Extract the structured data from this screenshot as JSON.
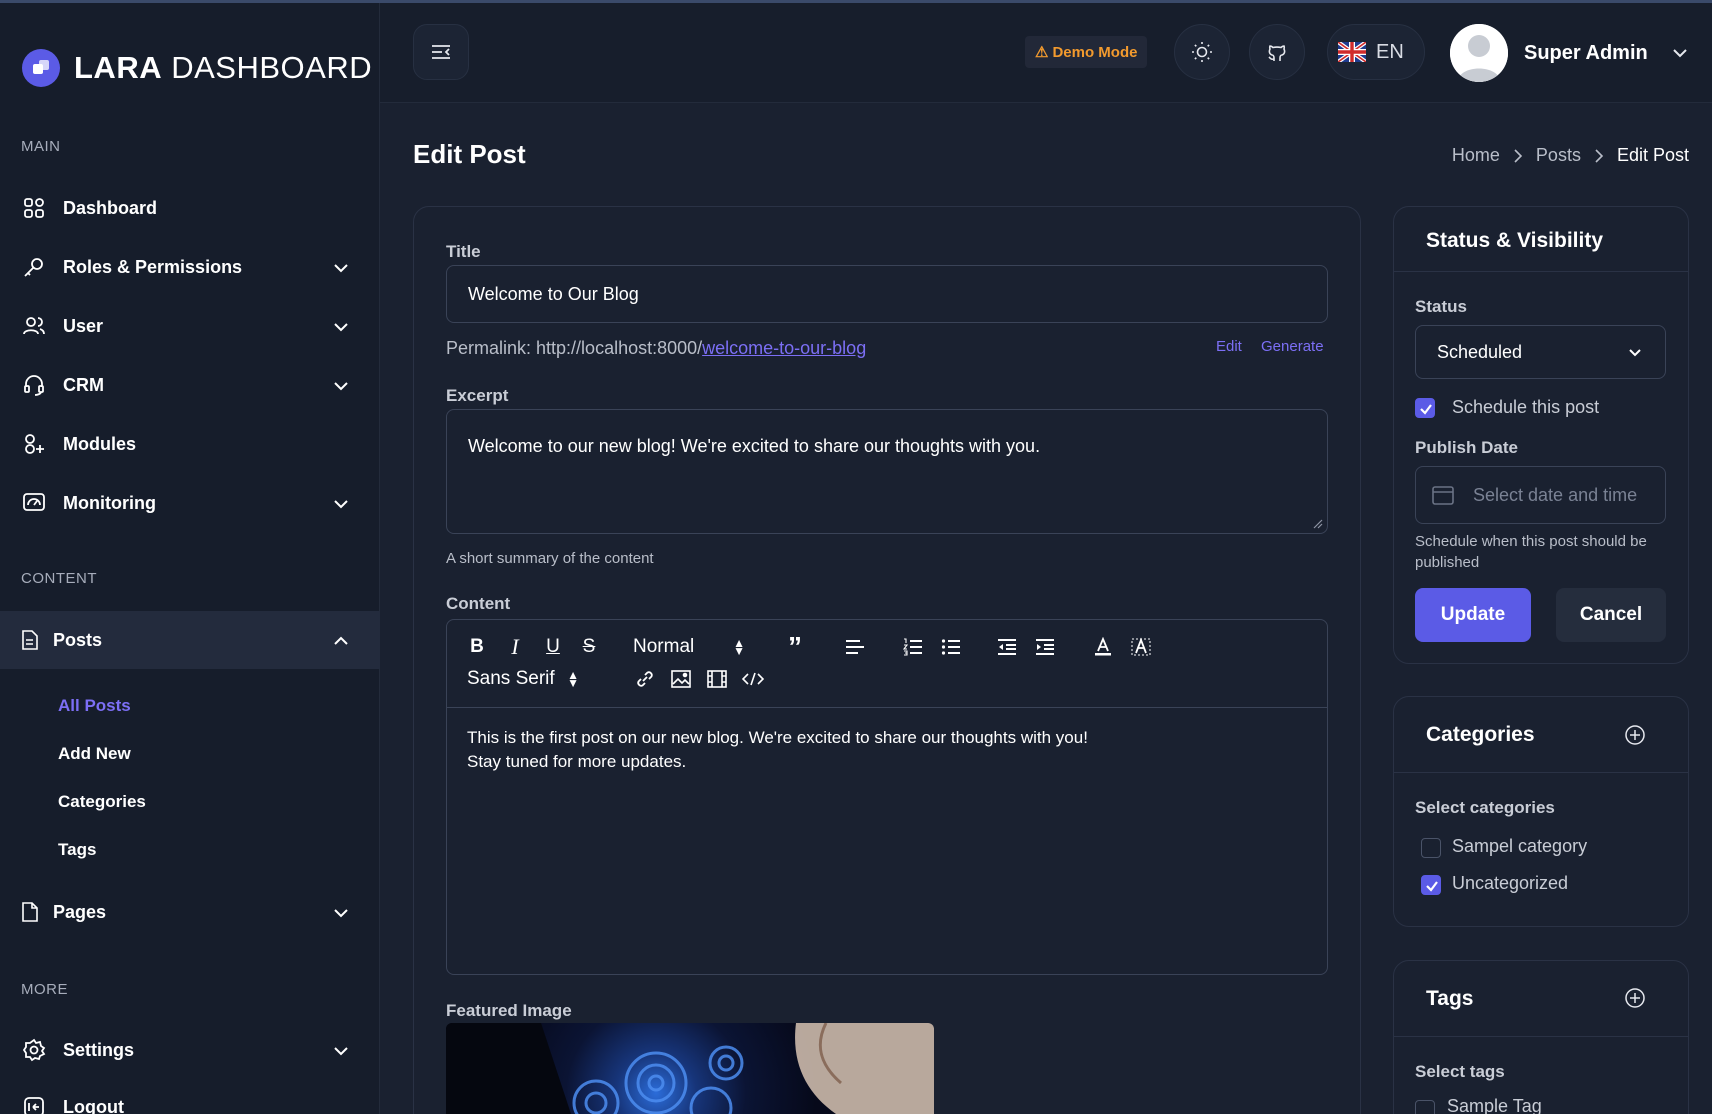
{
  "brand": {
    "bold": "LARA",
    "light": "DASHBOARD"
  },
  "sidebar": {
    "sections": {
      "main": "MAIN",
      "content": "CONTENT",
      "more": "MORE"
    },
    "items": {
      "dashboard": "Dashboard",
      "roles": "Roles & Permissions",
      "user": "User",
      "crm": "CRM",
      "modules": "Modules",
      "monitoring": "Monitoring",
      "posts": "Posts",
      "pages": "Pages",
      "settings": "Settings",
      "logout": "Logout"
    },
    "posts_sub": {
      "all": "All Posts",
      "add": "Add New",
      "categories": "Categories",
      "tags": "Tags"
    }
  },
  "header": {
    "demo_label": "Demo Mode",
    "lang_code": "EN",
    "user_name": "Super Admin"
  },
  "page": {
    "title": "Edit Post",
    "breadcrumb": {
      "home": "Home",
      "posts": "Posts",
      "current": "Edit Post"
    }
  },
  "form": {
    "title_label": "Title",
    "title_value": "Welcome to Our Blog",
    "permalink_prefix": "Permalink: http://localhost:8000/",
    "permalink_slug": "welcome-to-our-blog",
    "permalink_edit": "Edit",
    "permalink_generate": "Generate",
    "excerpt_label": "Excerpt",
    "excerpt_value": "Welcome to our new blog! We're excited to share our thoughts with you.",
    "excerpt_hint": "A short summary of the content",
    "content_label": "Content",
    "toolbar": {
      "header_select": "Normal",
      "font_select": "Sans Serif"
    },
    "content_line1": "This is the first post on our new blog. We're excited to share our thoughts with you!",
    "content_line2": "Stay tuned for more updates.",
    "featured_label": "Featured Image"
  },
  "status_card": {
    "title": "Status & Visibility",
    "status_label": "Status",
    "status_value": "Scheduled",
    "schedule_checkbox": "Schedule this post",
    "schedule_checked": true,
    "publish_label": "Publish Date",
    "publish_placeholder": "Select date and time",
    "publish_hint_1": "Schedule when this post should be",
    "publish_hint_2": "published",
    "update_btn": "Update",
    "cancel_btn": "Cancel"
  },
  "categories_card": {
    "title": "Categories",
    "select_label": "Select categories",
    "items": [
      {
        "label": "Sampel category",
        "checked": false
      },
      {
        "label": "Uncategorized",
        "checked": true
      }
    ]
  },
  "tags_card": {
    "title": "Tags",
    "select_label": "Select tags",
    "items": [
      {
        "label": "Sample Tag",
        "checked": false
      }
    ]
  },
  "colors": {
    "accent": "#5b5be6",
    "link": "#7c6ff5",
    "warning": "#f29a2e",
    "bg": "#1a2130",
    "sidebar": "#161d2b"
  }
}
